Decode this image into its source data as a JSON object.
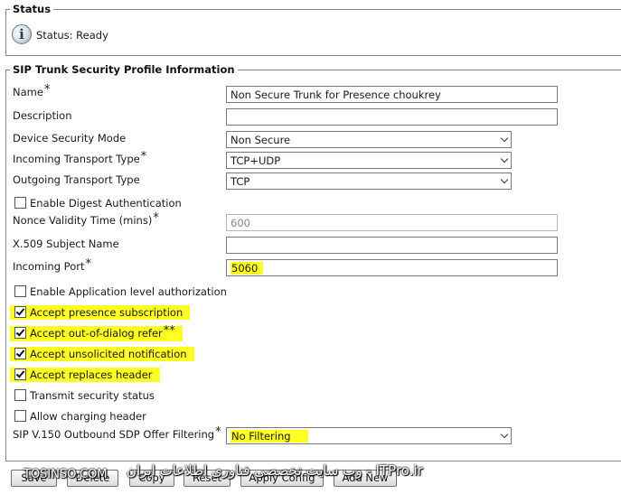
{
  "status": {
    "legend": "Status",
    "text": "Status: Ready"
  },
  "sip_profile": {
    "legend": "SIP Trunk Security Profile Information",
    "required_mark": "*",
    "fields": {
      "name": {
        "label": "Name",
        "value": "Non Secure Trunk for Presence choukrey"
      },
      "description": {
        "label": "Description",
        "value": ""
      },
      "device_security_mode": {
        "label": "Device Security Mode",
        "value": "Non Secure"
      },
      "incoming_transport": {
        "label": "Incoming Transport Type",
        "value": "TCP+UDP"
      },
      "outgoing_transport": {
        "label": "Outgoing Transport Type",
        "value": "TCP"
      },
      "digest_auth": {
        "label": "Enable Digest Authentication",
        "checked": false
      },
      "nonce_validity": {
        "label": "Nonce Validity Time (mins)",
        "value": "600"
      },
      "x509_subject": {
        "label": "X.509 Subject Name",
        "value": ""
      },
      "incoming_port": {
        "label": "Incoming Port",
        "value": "5060"
      },
      "app_level_auth": {
        "label": "Enable Application level authorization",
        "checked": false
      },
      "accept_presence": {
        "label": "Accept presence subscription",
        "checked": true
      },
      "accept_ood_refer": {
        "label": "Accept out-of-dialog refer",
        "suffix": "**",
        "checked": true
      },
      "accept_unsolicited": {
        "label": "Accept unsolicited notification",
        "checked": true
      },
      "accept_replaces": {
        "label": "Accept replaces header",
        "checked": true
      },
      "transmit_security": {
        "label": "Transmit security status",
        "checked": false
      },
      "allow_charging": {
        "label": "Allow charging header",
        "checked": false
      },
      "sdp_filtering": {
        "label": "SIP V.150 Outbound SDP Offer Filtering",
        "value": "No Filtering"
      }
    }
  },
  "buttons": {
    "save": "Save",
    "delete": "Delete",
    "copy": "Copy",
    "reset": "Reset",
    "apply_config": "Apply Config",
    "add_new": "Add New"
  },
  "watermark": {
    "left": "TOSINSO.COM",
    "right": "وب سایت تخصصی فناوری اطلاعات ایران - ITPro.ir"
  },
  "colors": {
    "highlight": "#ffff24",
    "border": "#8a8a8a"
  }
}
